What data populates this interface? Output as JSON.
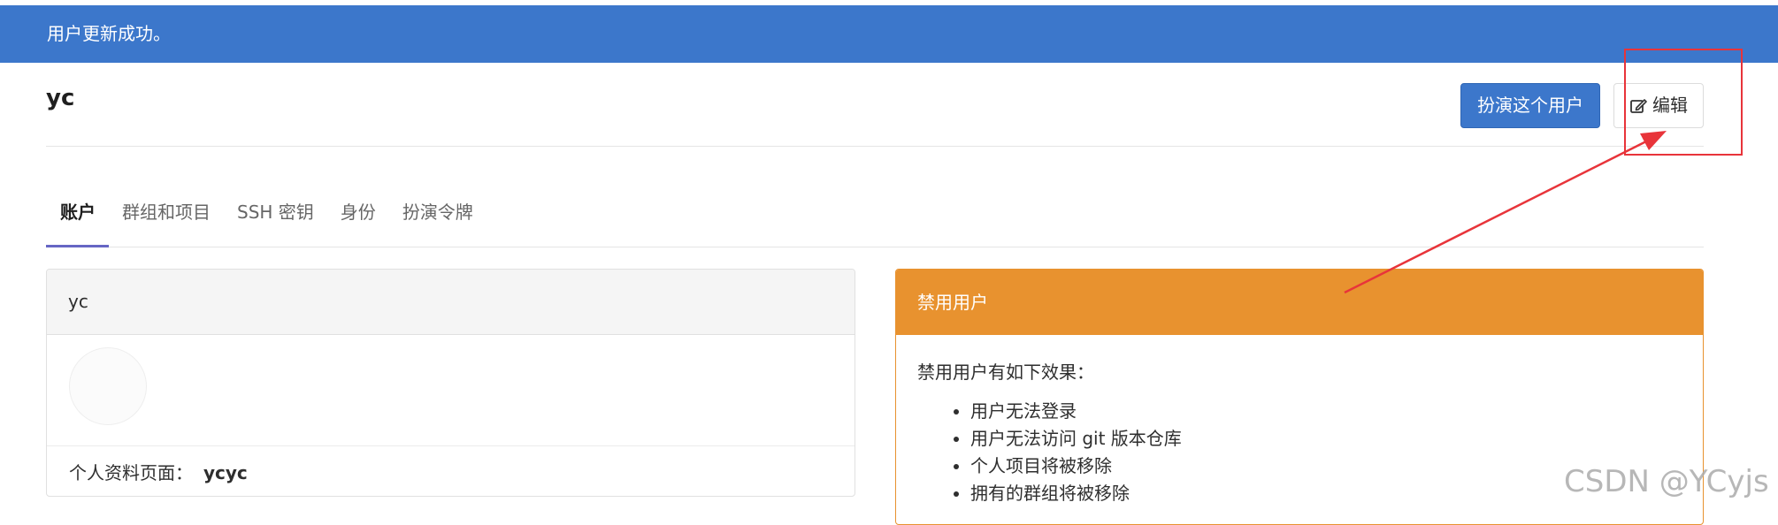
{
  "flash": {
    "message": "用户更新成功。"
  },
  "header": {
    "username": "yc",
    "impersonate_label": "扮演这个用户",
    "edit_label": "编辑"
  },
  "tabs": [
    {
      "label": "账户",
      "active": true
    },
    {
      "label": "群组和项目",
      "active": false
    },
    {
      "label": "SSH 密钥",
      "active": false
    },
    {
      "label": "身份",
      "active": false
    },
    {
      "label": "扮演令牌",
      "active": false
    }
  ],
  "account_card": {
    "title": "yc",
    "profile_label": "个人资料页面：",
    "profile_value": "ycyc"
  },
  "ban_card": {
    "title": "禁用用户",
    "intro": "禁用用户有如下效果：",
    "effects": [
      "用户无法登录",
      "用户无法访问 git 版本仓库",
      "个人项目将被移除",
      "拥有的群组将被移除"
    ]
  },
  "watermark": "CSDN @YCyjs",
  "colors": {
    "primary": "#3c77cb",
    "warning": "#e8922f",
    "tab_active_underline": "#6666c4",
    "annotation": "#e8343a"
  },
  "icons": {
    "edit": "pencil-square-icon"
  }
}
